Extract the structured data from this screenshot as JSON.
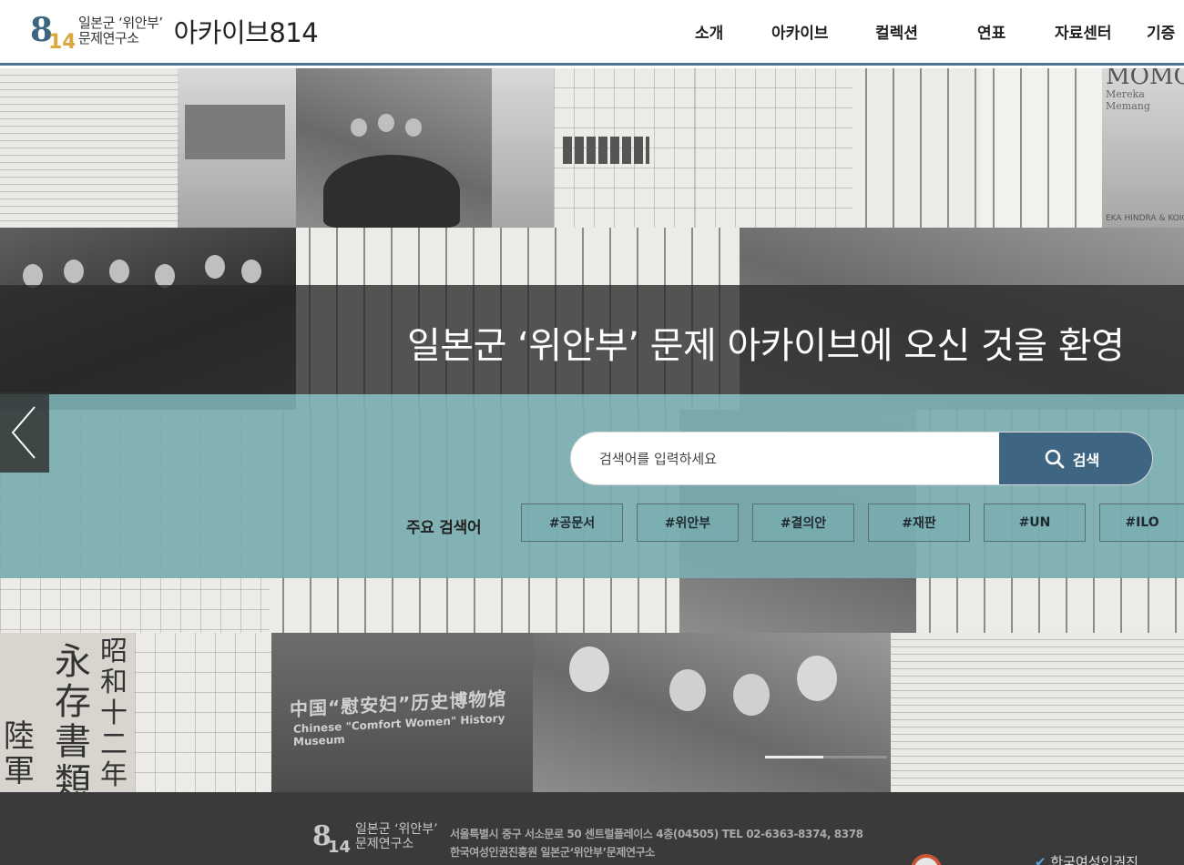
{
  "header": {
    "logo_line1": "일본군 ‘위안부’",
    "logo_line2": "문제연구소",
    "logo_archive": "아카이브814",
    "logo_accent_color": "#3e6581",
    "nav": [
      {
        "label": "소개"
      },
      {
        "label": "아카이브"
      },
      {
        "label": "컬렉션"
      },
      {
        "label": "연표"
      },
      {
        "label": "자료센터"
      },
      {
        "label": "기증"
      }
    ]
  },
  "hero": {
    "welcome": "일본군 ‘위안부’ 문제 아카이브에 오신 것을 환영",
    "background_images": {
      "museum_title": "中国“慰安妇”历史博物馆",
      "museum_subtitle": "Chinese \"Comfort Women\" History Museum",
      "book_title": "MOMO",
      "book_subtitle": "Mereka Memang",
      "book_author": "EKA HINDRA & KOICHI",
      "document_characters": "永存書類",
      "document_characters_2": "昭和十二年",
      "document_characters_3": "陸軍"
    },
    "prev_icon": "chevron-left-icon"
  },
  "search": {
    "placeholder": "검색어를 입력하세요",
    "button_label": "검색",
    "button_icon": "search-icon",
    "button_color": "#3e6581",
    "band_color": "#78adaf"
  },
  "keywords": {
    "label": "주요 검색어",
    "items": [
      "#공문서",
      "#위안부",
      "#결의안",
      "#재판",
      "#UN",
      "#ILO"
    ]
  },
  "footer": {
    "logo_line1": "일본군 ‘위안부’",
    "logo_line2": "문제연구소",
    "address": "서울특별시 중구 서소문로 50 센트럴플레이스 4층(04505) TEL 02-6363-8374, 8378",
    "org": "한국여성인권진흥원 일본군‘위안부’문제연구소",
    "partner": "한국여성인권진"
  }
}
